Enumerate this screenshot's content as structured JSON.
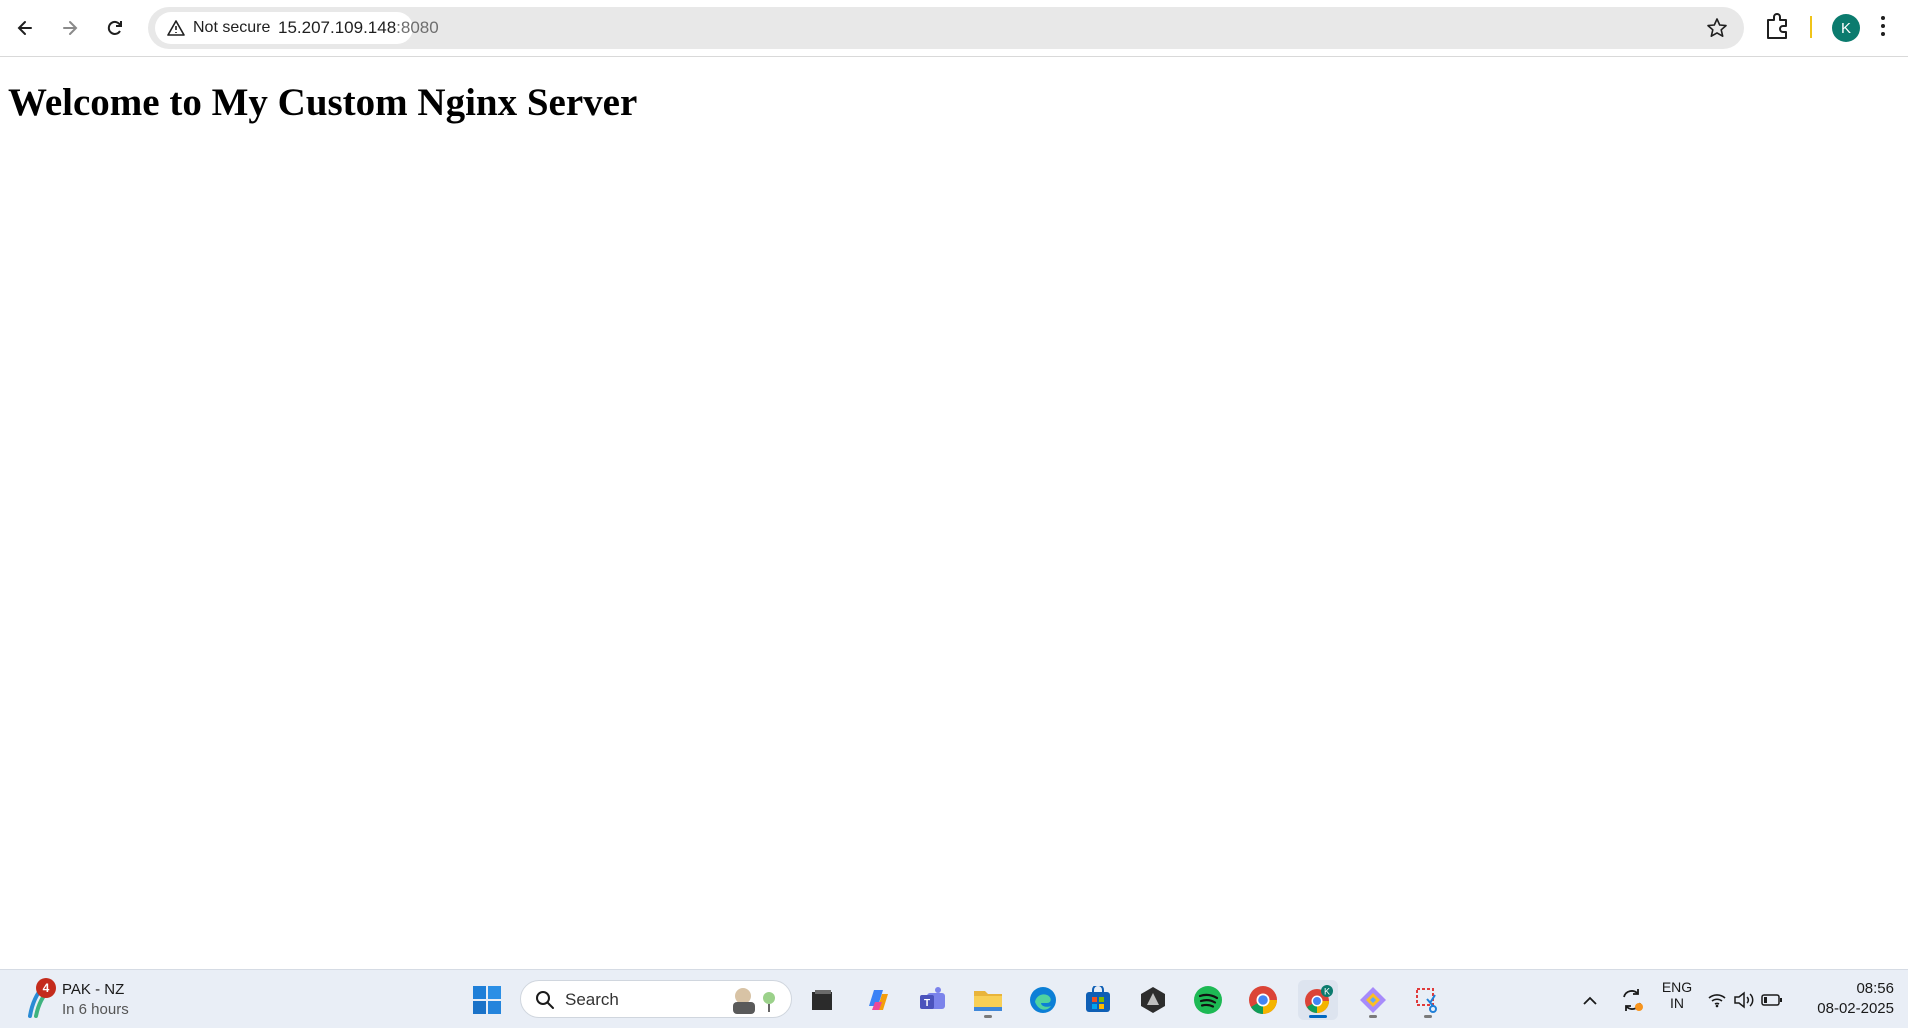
{
  "browser": {
    "security_label": "Not secure",
    "url_host": "15.207.109.148",
    "url_port": ":8080",
    "profile_initial": "K"
  },
  "page": {
    "heading": "Welcome to My Custom Nginx Server"
  },
  "taskbar": {
    "weather_badge": "4",
    "weather_title": "PAK - NZ",
    "weather_subtitle": "In 6 hours",
    "search_placeholder": "Search",
    "chrome_profile_badge": "K",
    "language_top": "ENG",
    "language_bottom": "IN",
    "time": "08:56",
    "date": "08-02-2025",
    "pinned_apps": [
      "start-icon",
      "file-manager-icon",
      "copilot-icon",
      "teams-icon",
      "file-explorer-icon",
      "edge-icon",
      "store-icon",
      "app-icon",
      "spotify-icon",
      "chrome-icon",
      "chrome-profile-icon",
      "app-icon",
      "snipping-tool-icon"
    ]
  },
  "colors": {
    "accent": "#0067c0",
    "avatar": "#0b7b6e"
  }
}
